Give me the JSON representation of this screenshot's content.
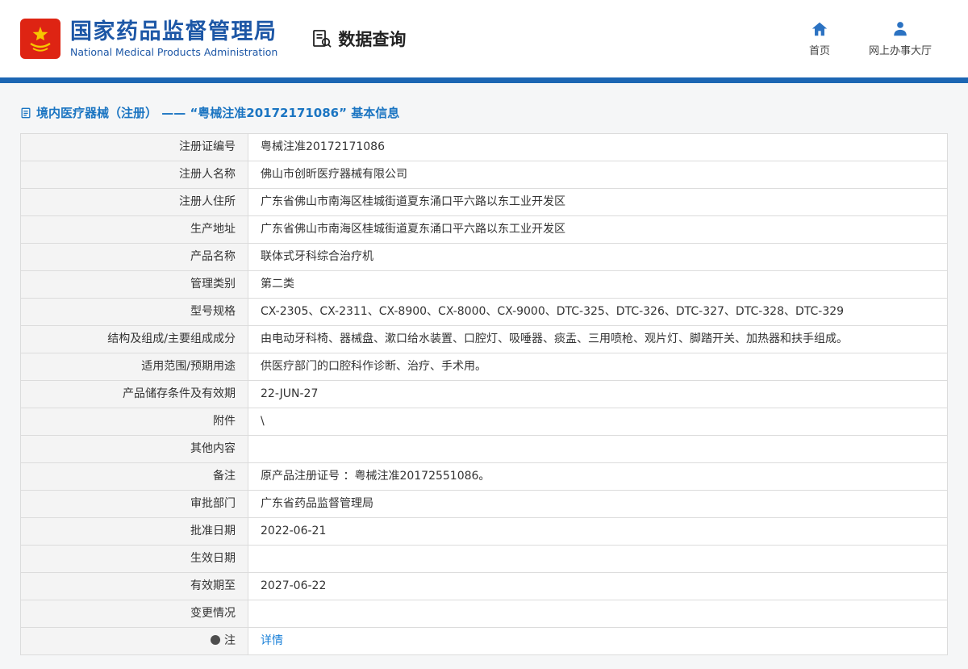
{
  "header": {
    "org_name_cn": "国家药品监督管理局",
    "org_name_en": "National Medical Products Administration",
    "section_title": "数据查询",
    "nav": [
      {
        "label": "首页",
        "icon": "home-icon"
      },
      {
        "label": "网上办事大厅",
        "icon": "user-icon"
      }
    ]
  },
  "page": {
    "title": "境内医疗器械（注册） —— “粤械注准20172171086” 基本信息"
  },
  "table": {
    "rows": [
      {
        "label": "注册证编号",
        "value": "粤械注准20172171086"
      },
      {
        "label": "注册人名称",
        "value": "佛山市创昕医疗器械有限公司"
      },
      {
        "label": "注册人住所",
        "value": "广东省佛山市南海区桂城街道夏东涌口平六路以东工业开发区"
      },
      {
        "label": "生产地址",
        "value": "广东省佛山市南海区桂城街道夏东涌口平六路以东工业开发区"
      },
      {
        "label": "产品名称",
        "value": "联体式牙科综合治疗机"
      },
      {
        "label": "管理类别",
        "value": "第二类"
      },
      {
        "label": "型号规格",
        "value": "CX-2305、CX-2311、CX-8900、CX-8000、CX-9000、DTC-325、DTC-326、DTC-327、DTC-328、DTC-329"
      },
      {
        "label": "结构及组成/主要组成成分",
        "value": "由电动牙科椅、器械盘、漱口给水装置、口腔灯、吸唾器、痰盂、三用喷枪、观片灯、脚踏开关、加热器和扶手组成。"
      },
      {
        "label": "适用范围/预期用途",
        "value": "供医疗部门的口腔科作诊断、治疗、手术用。"
      },
      {
        "label": "产品储存条件及有效期",
        "value": "22-JUN-27"
      },
      {
        "label": "附件",
        "value": "\\"
      },
      {
        "label": "其他内容",
        "value": ""
      },
      {
        "label": "备注",
        "value": "原产品注册证号 ：粤械注准20172551086。"
      },
      {
        "label": "审批部门",
        "value": "广东省药品监督管理局"
      },
      {
        "label": "批准日期",
        "value": "2022-06-21"
      },
      {
        "label": "生效日期",
        "value": ""
      },
      {
        "label": "有效期至",
        "value": "2027-06-22"
      },
      {
        "label": "变更情况",
        "value": ""
      },
      {
        "label": "注",
        "icon": "note-circle-icon",
        "link": true,
        "value": "详情"
      }
    ]
  },
  "colors": {
    "brand-blue": "#1d57a6",
    "bar-blue": "#1c66b3",
    "title-blue": "#1b75c2",
    "link-blue": "#1a80d8",
    "nav-icon-blue": "#2b72c2",
    "emblem-red": "#de2413",
    "emblem-gold": "#f7c600",
    "label-bg": "#f4f4f4",
    "cell-border": "#dcdcdc",
    "page-bg": "#f5f6f7"
  }
}
